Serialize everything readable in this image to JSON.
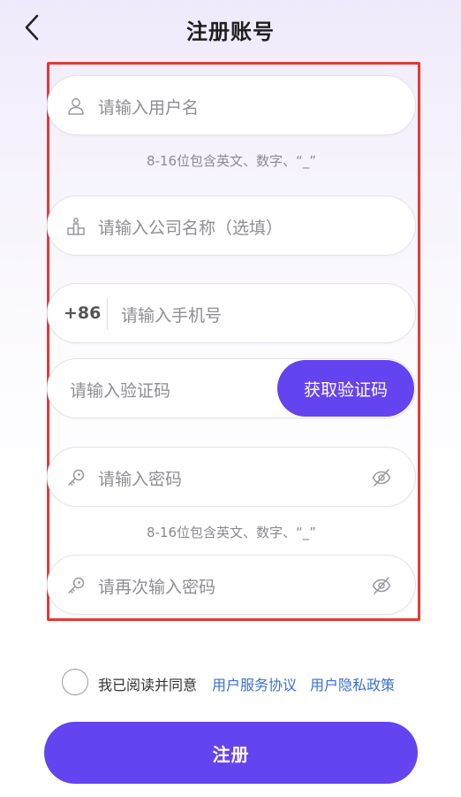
{
  "header": {
    "title": "注册账号",
    "back_icon": "chevron-left-icon"
  },
  "form": {
    "username": {
      "placeholder": "请输入用户名",
      "icon": "user-icon",
      "hint": "8-16位包含英文、数字、“_”"
    },
    "company": {
      "placeholder": "请输入公司名称（选填）",
      "icon": "building-icon"
    },
    "phone": {
      "country_code": "+86",
      "placeholder": "请输入手机号"
    },
    "verification": {
      "placeholder": "请输入验证码",
      "button_label": "获取验证码"
    },
    "password": {
      "placeholder": "请输入密码",
      "icon": "key-icon",
      "toggle_icon": "eye-off-icon",
      "hint": "8-16位包含英文、数字、“_”"
    },
    "confirm_password": {
      "placeholder": "请再次输入密码",
      "icon": "key-icon",
      "toggle_icon": "eye-off-icon"
    }
  },
  "agreement": {
    "checked": false,
    "text": "我已阅读并同意",
    "service_link": "用户服务协议",
    "privacy_link": "用户隐私政策"
  },
  "register_button": "注册",
  "colors": {
    "accent": "#6444f0",
    "link": "#3b6fd4",
    "highlight_border": "#e53935"
  }
}
